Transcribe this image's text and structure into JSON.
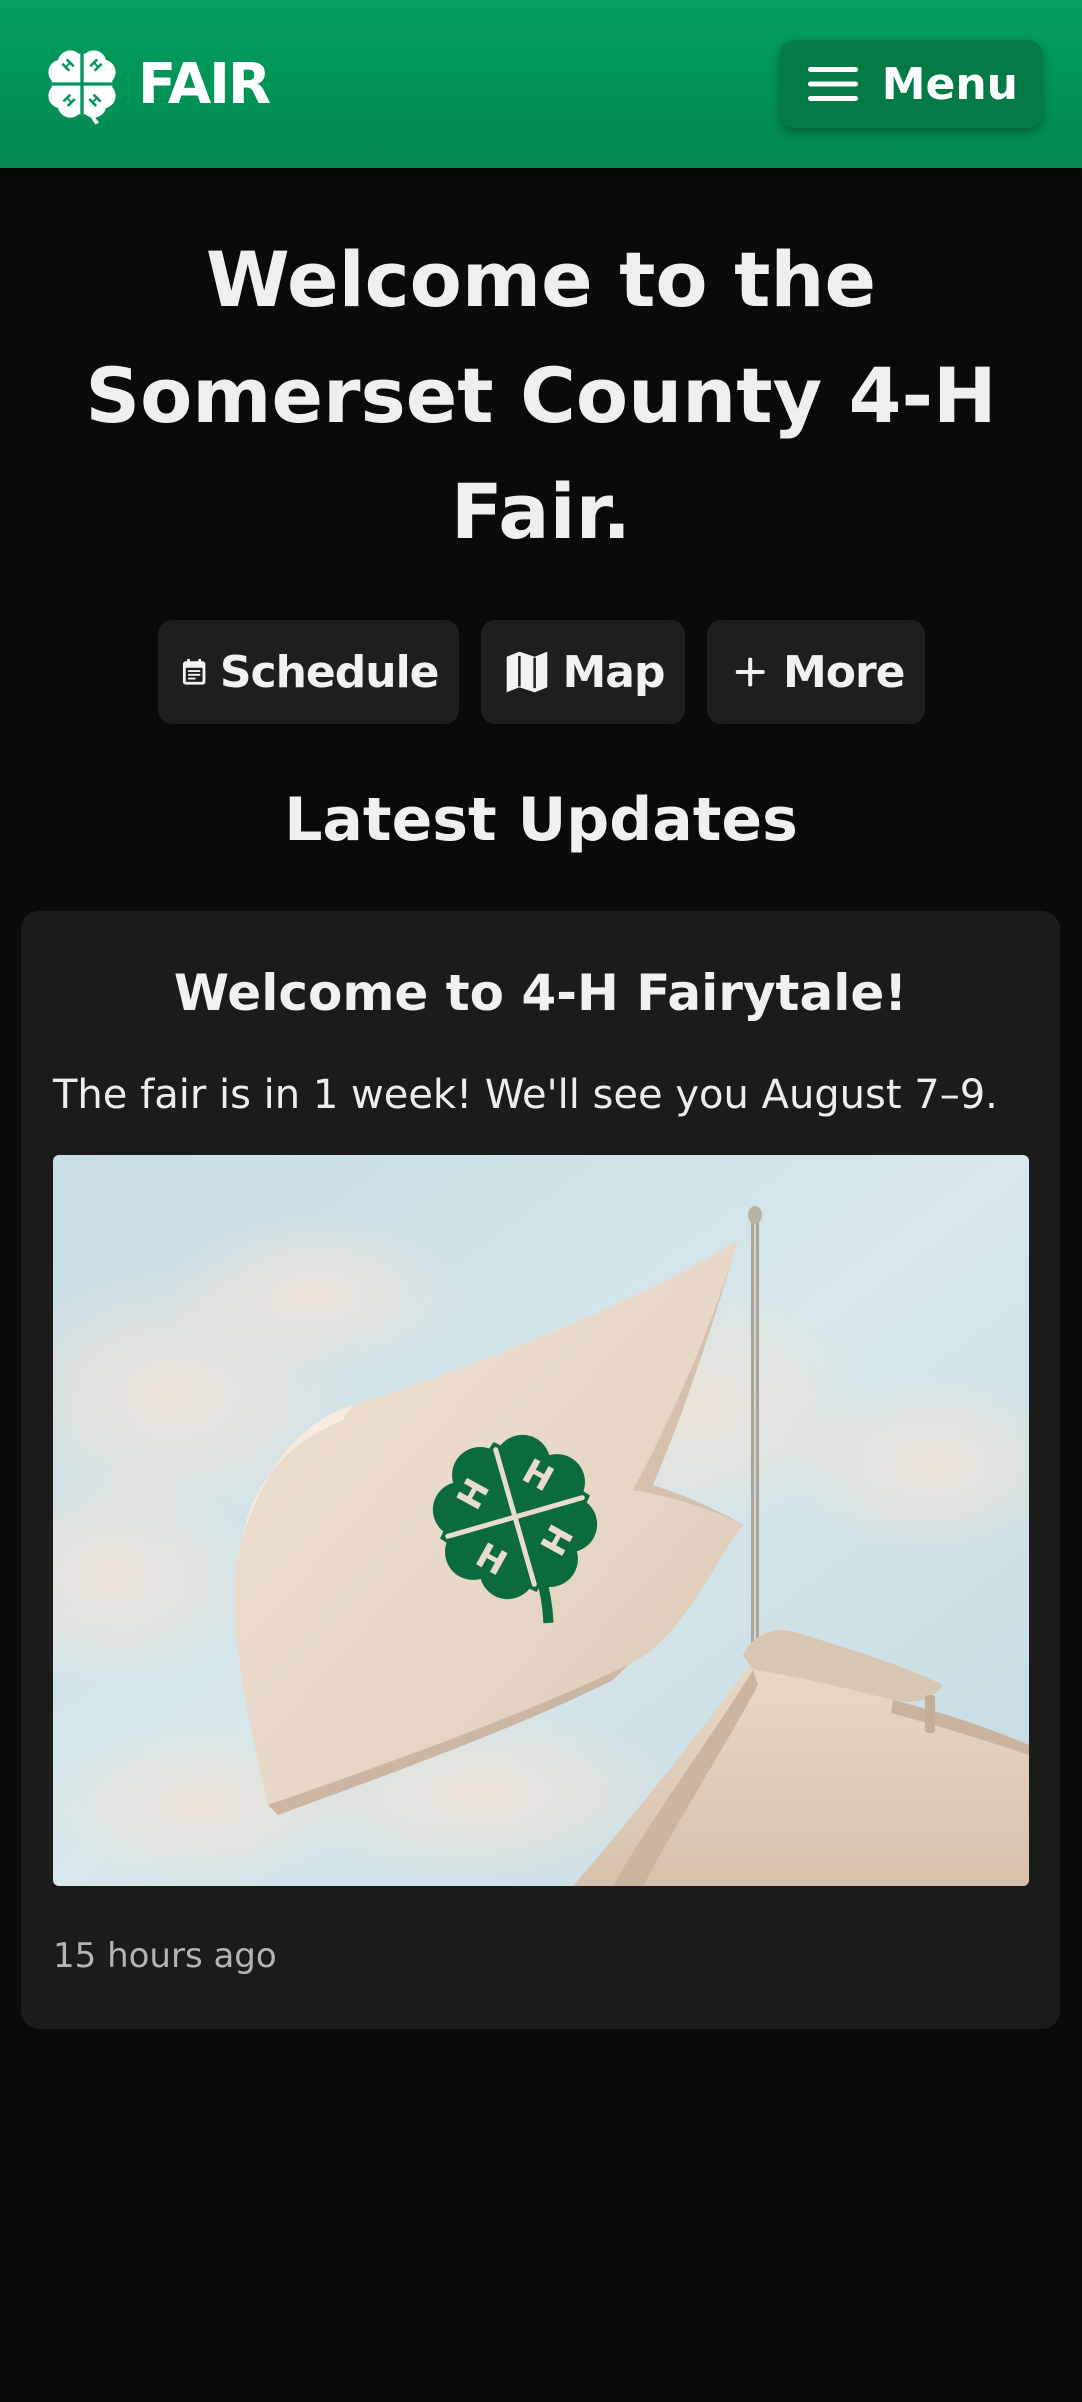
{
  "header": {
    "brand_text": "FAIR",
    "menu_label": "Menu"
  },
  "hero": {
    "title": "Welcome to the Somerset County 4-H Fair."
  },
  "quick_links": [
    {
      "label": "Schedule",
      "icon": "calendar-icon"
    },
    {
      "label": "Map",
      "icon": "map-icon"
    },
    {
      "label": "More",
      "icon": "plus-icon"
    }
  ],
  "updates": {
    "section_title": "Latest Updates",
    "posts": [
      {
        "title": "Welcome to 4-H Fairytale!",
        "body": "The fair is in 1 week! We'll see you August 7–9.",
        "image": "4-H clover flag on flagpole against cloudy sky",
        "timestamp": "15 hours ago"
      }
    ]
  },
  "colors": {
    "header_green": "#03a05f",
    "background": "#0a0a0a",
    "card": "#1b1b1b",
    "clover_green": "#0b6b3c"
  }
}
